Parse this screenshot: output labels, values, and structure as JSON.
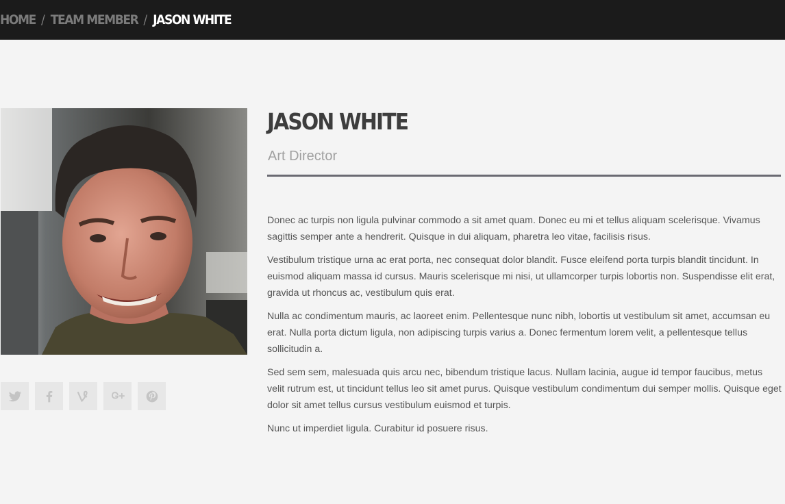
{
  "breadcrumb": {
    "home": "HOME",
    "section": "TEAM MEMBER",
    "current": "JASON WHITE",
    "separator": "/"
  },
  "profile": {
    "name": "JASON WHITE",
    "role": "Art Director",
    "photo_icon": "portrait-photo"
  },
  "bio": {
    "paragraphs": [
      "Donec ac turpis non ligula pulvinar commodo a sit amet quam. Donec eu mi et tellus aliquam scelerisque. Vivamus sagittis semper ante a hendrerit. Quisque in dui aliquam, pharetra leo vitae, facilisis risus.",
      "Vestibulum tristique urna ac erat porta, nec consequat dolor blandit. Fusce eleifend porta turpis blandit tincidunt. In euismod aliquam massa id cursus. Mauris scelerisque mi nisi, ut ullamcorper turpis lobortis non. Suspendisse elit erat, gravida ut rhoncus ac, vestibulum quis erat.",
      "Nulla ac condimentum mauris, ac laoreet enim. Pellentesque nunc nibh, lobortis ut vestibulum sit amet, accumsan eu erat. Nulla porta dictum ligula, non adipiscing turpis varius a. Donec fermentum lorem velit, a pellentesque tellus sollicitudin a.",
      "Sed sem sem, malesuada quis arcu nec, bibendum tristique lacus. Nullam lacinia, augue id tempor faucibus, metus velit rutrum est, ut tincidunt tellus leo sit amet purus. Quisque vestibulum condimentum dui semper mollis. Quisque eget dolor sit amet tellus cursus vestibulum euismod et turpis.",
      "Nunc ut imperdiet ligula. Curabitur id posuere risus."
    ]
  },
  "socials": [
    {
      "icon": "twitter-icon"
    },
    {
      "icon": "facebook-icon"
    },
    {
      "icon": "vine-icon"
    },
    {
      "icon": "google-plus-icon"
    },
    {
      "icon": "pinterest-icon"
    }
  ],
  "colors": {
    "topbar": "#1b1b1b",
    "page_background": "#f4f4f4",
    "breadcrumb_link": "#7b7b7b",
    "breadcrumb_current": "#ffffff",
    "name": "#3d3d3d",
    "role": "#a0a0a0",
    "rule": "#6a6a72",
    "body_text": "#555555",
    "social_background": "#e7e7e7",
    "social_icon": "#c4c4c4"
  }
}
